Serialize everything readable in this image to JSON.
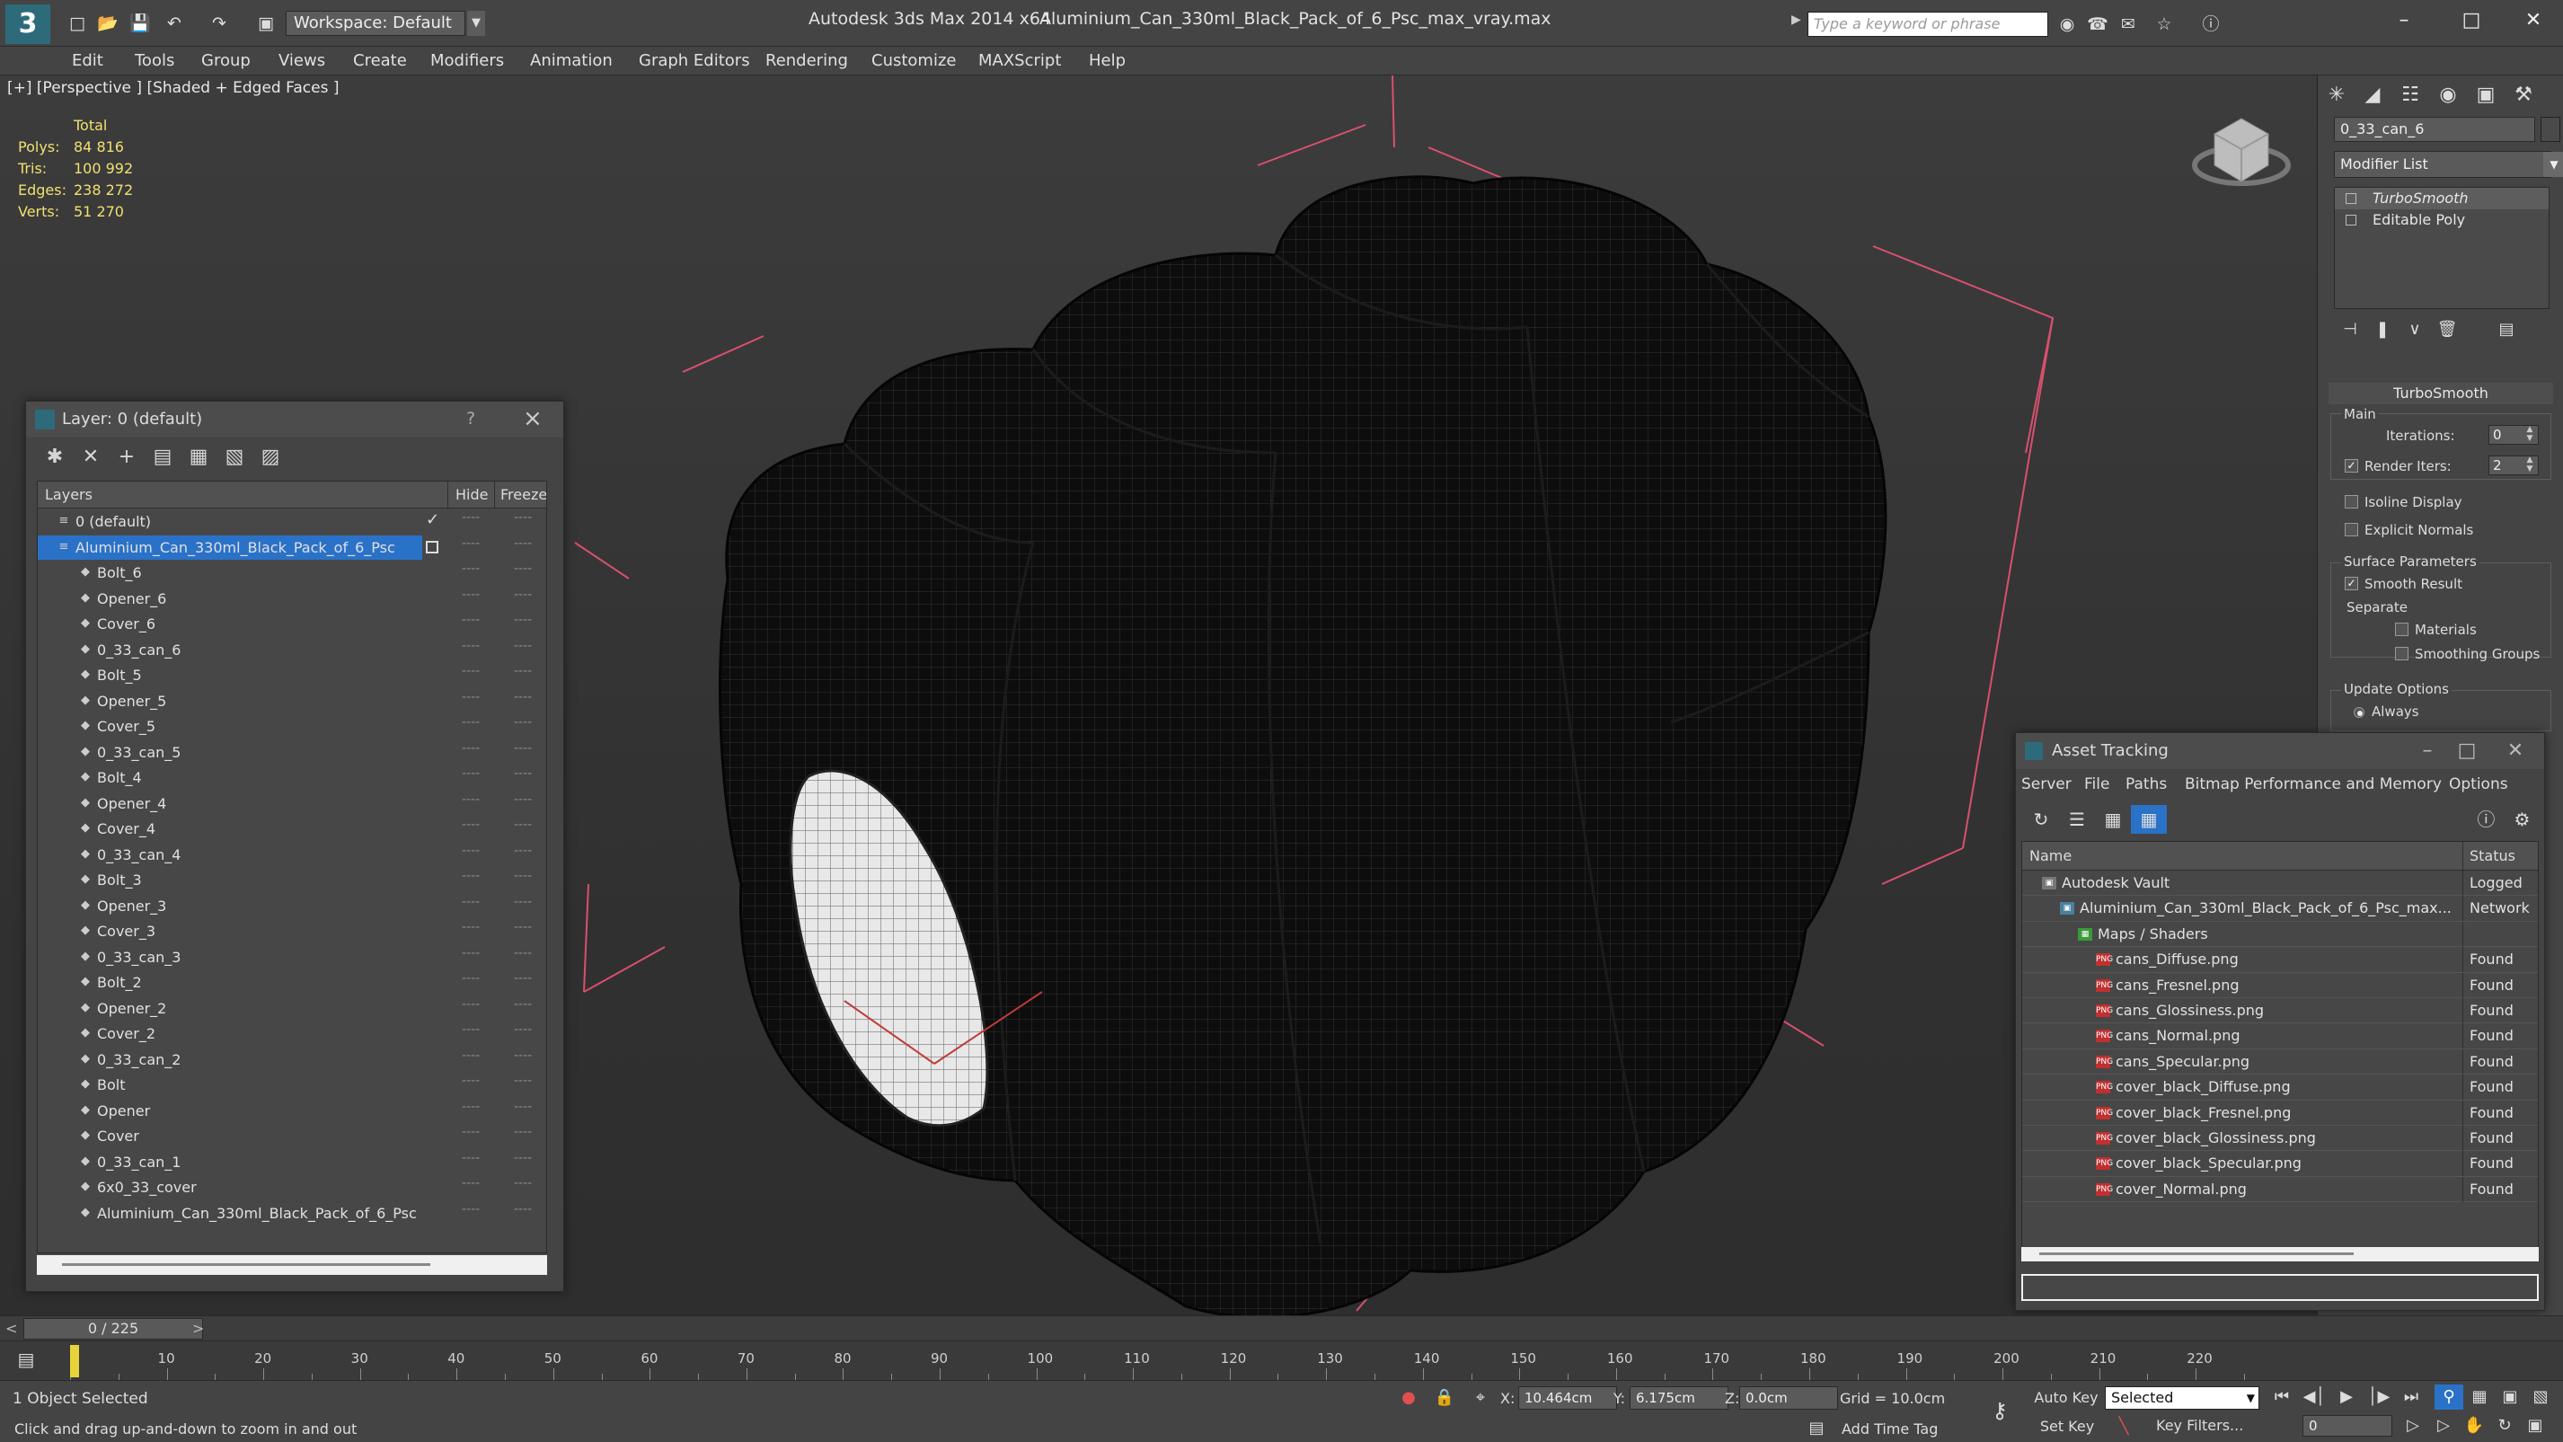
{
  "titlebar": {
    "workspace": "Workspace: Default",
    "app": "Autodesk 3ds Max  2014 x64",
    "file": "Aluminium_Can_330ml_Black_Pack_of_6_Psc_max_vray.max",
    "search_placeholder": "Type a keyword or phrase"
  },
  "menu": [
    "Edit",
    "Tools",
    "Group",
    "Views",
    "Create",
    "Modifiers",
    "Animation",
    "Graph Editors",
    "Rendering",
    "Customize",
    "MAXScript",
    "Help"
  ],
  "viewport": {
    "label": "[+] [Perspective ] [Shaded + Edged Faces ]",
    "stats": {
      "total_label": "Total",
      "polys_label": "Polys:",
      "polys": "84 816",
      "tris_label": "Tris:",
      "tris": "100 992",
      "edges_label": "Edges:",
      "edges": "238 272",
      "verts_label": "Verts:",
      "verts": "51 270"
    }
  },
  "layer_panel": {
    "title": "Layer: 0 (default)",
    "help": "?",
    "col_layers": "Layers",
    "col_hide": "Hide",
    "col_freeze": "Freeze",
    "rows": [
      {
        "label": "0 (default)",
        "level": 0,
        "state": "check"
      },
      {
        "label": "Aluminium_Can_330ml_Black_Pack_of_6_Psc",
        "level": 0,
        "state": "box",
        "selected": true
      },
      {
        "label": "Bolt_6",
        "level": 1
      },
      {
        "label": "Opener_6",
        "level": 1
      },
      {
        "label": "Cover_6",
        "level": 1
      },
      {
        "label": "0_33_can_6",
        "level": 1
      },
      {
        "label": "Bolt_5",
        "level": 1
      },
      {
        "label": "Opener_5",
        "level": 1
      },
      {
        "label": "Cover_5",
        "level": 1
      },
      {
        "label": "0_33_can_5",
        "level": 1
      },
      {
        "label": "Bolt_4",
        "level": 1
      },
      {
        "label": "Opener_4",
        "level": 1
      },
      {
        "label": "Cover_4",
        "level": 1
      },
      {
        "label": "0_33_can_4",
        "level": 1
      },
      {
        "label": "Bolt_3",
        "level": 1
      },
      {
        "label": "Opener_3",
        "level": 1
      },
      {
        "label": "Cover_3",
        "level": 1
      },
      {
        "label": "0_33_can_3",
        "level": 1
      },
      {
        "label": "Bolt_2",
        "level": 1
      },
      {
        "label": "Opener_2",
        "level": 1
      },
      {
        "label": "Cover_2",
        "level": 1
      },
      {
        "label": "0_33_can_2",
        "level": 1
      },
      {
        "label": "Bolt",
        "level": 1
      },
      {
        "label": "Opener",
        "level": 1
      },
      {
        "label": "Cover",
        "level": 1
      },
      {
        "label": "0_33_can_1",
        "level": 1
      },
      {
        "label": "6x0_33_cover",
        "level": 1
      },
      {
        "label": "Aluminium_Can_330ml_Black_Pack_of_6_Psc",
        "level": 1
      }
    ],
    "hide_marker": "----",
    "freeze_marker": "----"
  },
  "command_panel": {
    "object_name": "0_33_can_6",
    "modifier_list": "Modifier List",
    "stack": [
      "TurboSmooth",
      "Editable Poly"
    ],
    "rollout_title": "TurboSmooth",
    "rollout_minus": "-",
    "main_label": "Main",
    "iterations_label": "Iterations:",
    "iterations": "0",
    "render_iters_label": "Render Iters:",
    "render_iters": "2",
    "isoline_label": "Isoline Display",
    "explicit_label": "Explicit Normals",
    "surface_label": "Surface Parameters",
    "smooth_label": "Smooth Result",
    "separate_label": "Separate",
    "materials_label": "Materials",
    "smoothing_label": "Smoothing Groups",
    "update_label": "Update Options",
    "always_label": "Always"
  },
  "asset_tracking": {
    "title": "Asset Tracking",
    "menu": [
      "Server",
      "File",
      "Paths",
      "Bitmap Performance and Memory",
      "Options"
    ],
    "col_name": "Name",
    "col_status": "Status",
    "rows": [
      {
        "name": "Autodesk Vault",
        "status": "Logged",
        "level": 0,
        "icon": "vault"
      },
      {
        "name": "Aluminium_Can_330ml_Black_Pack_of_6_Psc_max...",
        "status": "Network",
        "level": 1,
        "icon": "max"
      },
      {
        "name": "Maps / Shaders",
        "status": "",
        "level": 2,
        "icon": "maps"
      },
      {
        "name": "cans_Diffuse.png",
        "status": "Found",
        "level": 3,
        "icon": "png"
      },
      {
        "name": "cans_Fresnel.png",
        "status": "Found",
        "level": 3,
        "icon": "png"
      },
      {
        "name": "cans_Glossiness.png",
        "status": "Found",
        "level": 3,
        "icon": "png"
      },
      {
        "name": "cans_Normal.png",
        "status": "Found",
        "level": 3,
        "icon": "png"
      },
      {
        "name": "cans_Specular.png",
        "status": "Found",
        "level": 3,
        "icon": "png"
      },
      {
        "name": "cover_black_Diffuse.png",
        "status": "Found",
        "level": 3,
        "icon": "png"
      },
      {
        "name": "cover_black_Fresnel.png",
        "status": "Found",
        "level": 3,
        "icon": "png"
      },
      {
        "name": "cover_black_Glossiness.png",
        "status": "Found",
        "level": 3,
        "icon": "png"
      },
      {
        "name": "cover_black_Specular.png",
        "status": "Found",
        "level": 3,
        "icon": "png"
      },
      {
        "name": "cover_Normal.png",
        "status": "Found",
        "level": 3,
        "icon": "png"
      }
    ]
  },
  "timeline": {
    "position": "0 / 225",
    "left_arrow": "<",
    "right_arrow": ">",
    "ticks": [
      "10",
      "20",
      "30",
      "40",
      "50",
      "60",
      "70",
      "80",
      "90",
      "100",
      "110",
      "120",
      "130",
      "140",
      "150",
      "160",
      "170",
      "180",
      "190",
      "200",
      "210",
      "220"
    ]
  },
  "statusbar": {
    "selected": "1 Object Selected",
    "prompt": "Click and drag up-and-down to zoom in and out",
    "x_label": "X:",
    "x": "10.464cm",
    "y_label": "Y:",
    "y": "6.175cm",
    "z_label": "Z:",
    "z": "0.0cm",
    "grid": "Grid = 10.0cm",
    "add_time_tag": "Add Time Tag",
    "auto_key": "Auto Key",
    "set_key": "Set Key",
    "selected_drop": "Selected",
    "key_filters": "Key Filters...",
    "frame": "0"
  },
  "colors": {
    "accent": "#2a72c8",
    "stats_text": "#f0e070",
    "grid_lines": "#d8506e"
  }
}
